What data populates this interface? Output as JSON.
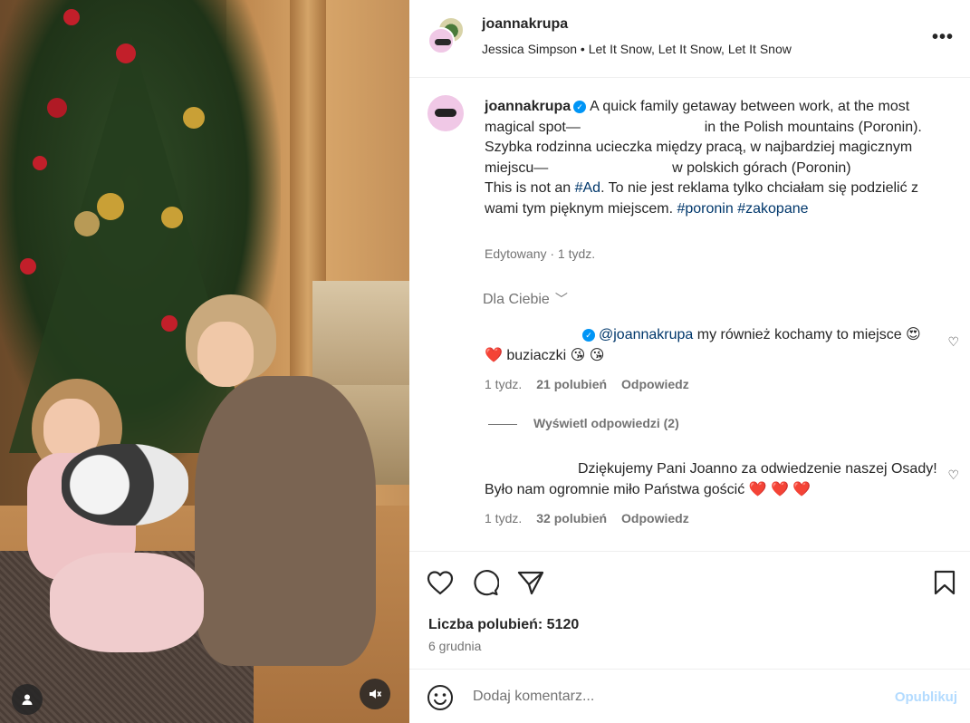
{
  "header": {
    "username": "joannakrupa",
    "music": "Jessica Simpson • Let It Snow, Let It Snow, Let It Snow",
    "more_icon": "more-horizontal-icon"
  },
  "caption": {
    "username": "joannakrupa",
    "text_1": "A quick family getaway between work, at the most magical spot—",
    "text_2": "in the Polish mountains (Poronin).",
    "text_3": "Szybka rodzinna ucieczka między pracą, w najbardziej magicznym miejscu—",
    "text_4": "w polskich górach (Poronin)",
    "text_5": "This is not an",
    "tag_ad": "#Ad",
    "text_6": ". To nie jest reklama tylko chciałam się podzielić z wami tym pięknym miejscem.",
    "tag_poronin": "#poronin",
    "tag_zakopane": "#zakopane",
    "meta": "Edytowany · 1 tydz."
  },
  "for_you": "Dla Ciebie",
  "comments": [
    {
      "mention": "@joannakrupa",
      "text": "my również kochamy to miejsce 😍 ❤️  buziaczki 😘 😘",
      "time": "1 tydz.",
      "likes": "21 polubień",
      "reply": "Odpowiedz"
    },
    {
      "text": "Dziękujemy Pani Joanno za odwiedzenie naszej Osady! Było nam ogromnie miło Państwa gościć ❤️ ❤️ ❤️",
      "time": "1 tydz.",
      "likes": "32 polubień",
      "reply": "Odpowiedz"
    }
  ],
  "view_replies": "Wyświetl odpowiedzi (2)",
  "actions": {
    "likes_label": "Liczba polubień: 5120",
    "date": "6 grudnia"
  },
  "add_comment": {
    "placeholder": "Dodaj komentarz...",
    "publish": "Opublikuj"
  },
  "colors": {
    "link": "#00376b",
    "verified": "#0095f6",
    "publish_disabled": "#b3dbff",
    "secondary_text": "#737373"
  }
}
